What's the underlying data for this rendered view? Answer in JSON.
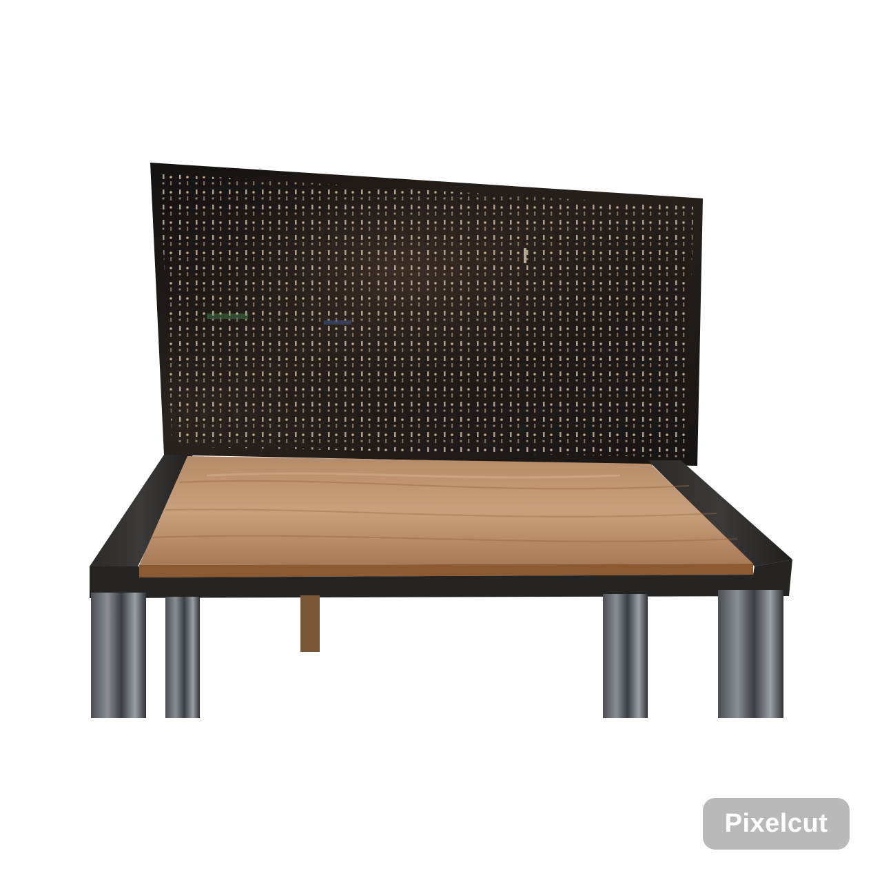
{
  "image": {
    "subject": "workbench",
    "components": [
      "pegboard-backpanel",
      "wood-worktop",
      "steel-frame",
      "legs-wrapped-in-plastic"
    ],
    "colors": {
      "pegboard": "#1e1a17",
      "frame": "#22201e",
      "wood_light": "#c79d79",
      "wood_dark": "#9a6c48",
      "wood_edge": "#8b5a33",
      "wrap": "#6a6e72",
      "background": "#ffffff"
    }
  },
  "watermark": {
    "label": "Pixelcut",
    "background": "#b9b9b9",
    "color": "#ffffff"
  }
}
